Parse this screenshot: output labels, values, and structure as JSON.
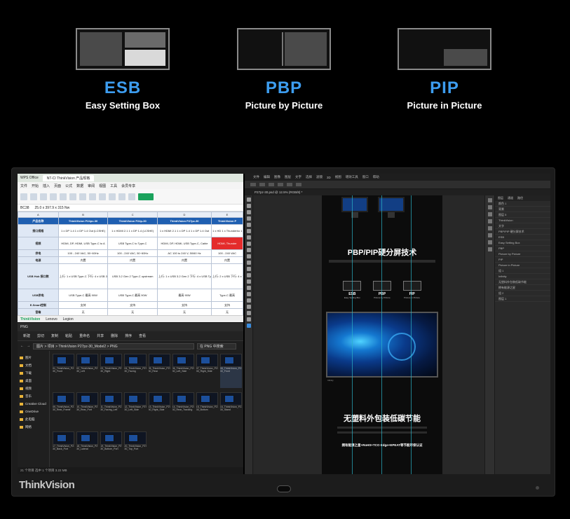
{
  "modes": [
    {
      "title": "ESB",
      "subtitle": "Easy Setting Box"
    },
    {
      "title": "PBP",
      "subtitle": "Picture by Picture"
    },
    {
      "title": "PIP",
      "subtitle": "Picture in Picture"
    }
  ],
  "monitor": {
    "brand": "ThinkVision"
  },
  "spreadsheet": {
    "app_tab": "WPS Office",
    "file_tab": "NT-CI ThinkVision 产品规格",
    "menus": [
      "文件",
      "开始",
      "插入",
      "页面",
      "公式",
      "数据",
      "审阅",
      "视图",
      "工具",
      "会员专享"
    ],
    "cell_ref": "BC38",
    "formula": "25.0 x 397.9 x 315 Nw",
    "columns": [
      "A",
      "B",
      "C",
      "D",
      "E"
    ],
    "header_row": [
      "产品名称",
      "ThinkVision P24pv-30",
      "ThinkVision P24p-30",
      "ThinkVision P27pz-30",
      "ThinkVision P"
    ],
    "rows": [
      {
        "label": "接口规格",
        "cells": [
          "1 x DP 1.4\n1 x DP 1.4 Out\n(LCSHE)",
          "1 x HDMI 2.1\n1 x DP 1.4\n(LCSHE)",
          "1 x HDMI 2.1\n1 x DP 1.4\n1 x DP 1.4 Out",
          "1 x HD\n1 x Thunderbo\n1 x Thunderbo"
        ]
      },
      {
        "label": "视频",
        "cells": [
          "HDMI, DP, HDMI, USB Type-C to A",
          "USB Type-C to Type-C",
          "HDMI, DP, HDMI, USB Type-C, Cable",
          "HDMI, Thunder"
        ]
      },
      {
        "label": "供电",
        "cells": [
          "100 - 240 VAC, 50~60Hz",
          "100 - 240 VAC, 50~60Hz",
          "AC 100 to 240 V, 50/60 Hz",
          "100 - 240 VAC"
        ]
      },
      {
        "label": "电源",
        "cells": [
          "内置",
          "内置",
          "内置",
          "内置"
        ]
      },
      {
        "label": "USB Hub 接口数",
        "cells": [
          "上行: 1 x USB Type-C\n下行: 4 x USB 3.2 Gen 2",
          "USB 3.2 Gen 2\nType-C upstream",
          "上行: 1 x USB 3.2 Gen 2\n下行: 4 x USB Type-A",
          "上行: 2 x USB\n下行: 4 x Thu"
        ]
      },
      {
        "label": "USB供电",
        "cells": [
          "USB Type-C 最高 90W",
          "USB Type-C 最高 90W",
          "最高 90W",
          "Type-C 最高"
        ]
      },
      {
        "label": "E-Smart控制",
        "cells": [
          "支持",
          "支持",
          "支持",
          "支持"
        ]
      },
      {
        "label": "音箱",
        "cells": [
          "无",
          "无",
          "无",
          "无"
        ]
      }
    ],
    "sheet_tabs": [
      "ThinkVision",
      "Lenovo",
      "Legion"
    ],
    "active_sheet": "ThinkVision"
  },
  "explorer": {
    "title": "PNG",
    "tools": [
      "新建",
      "剪切",
      "复制",
      "粘贴",
      "重命名",
      "共享",
      "删除",
      "排序",
      "查看"
    ],
    "path": "图片 > 项目 > ThinkVision P27pz-30_Model2 > PNG",
    "search_placeholder": "在 PNG 中搜索",
    "nav": [
      "图片",
      "文档",
      "下载",
      "桌面",
      "视频",
      "音乐",
      "Creative Cloud",
      "OneDrive",
      "此电脑",
      "网络"
    ],
    "files": [
      "01_ThinkVision_P27pz-30_Front",
      "02_ThinkVision_P27pz-30_Left",
      "03_ThinkVision_P27pz-30_Right",
      "04_ThinkVision_P27pz-30_Facing",
      "05_ThinkVision_P27pz-30_Rear",
      "06_ThinkVision_P27pz-30_Left_Side",
      "07_ThinkVision_P27pz-30_Right_Side",
      "08_ThinkVision_P27pz-30_Front",
      "09_ThinkVision_P27pz-30_Rear_Frame",
      "10_ThinkVision_P27pz-30_Rear_Port",
      "11_ThinkVision_P27pz-30_Facing_Left",
      "12_ThinkVision_P27pz-30_Left_Side",
      "13_ThinkVision_P27pz-30_Right_Side",
      "14_ThinkVision_P27pz-30_Rear_Tracking",
      "15_ThinkVision_P27pz-30_Bottom",
      "16_ThinkVision_P27pz-30_Stand",
      "17_ThinkVision_P27pz-30_Back_Port",
      "18_ThinkVision_P27pz-30_Lateral",
      "19_ThinkVision_P27pz-30_Bottom_Port",
      "20_ThinkVision_P27pz-30_Top_Port"
    ],
    "status": "21 个项目  选中 1 个项目  3.22 MB"
  },
  "photoshop": {
    "menus": [
      "文件",
      "编辑",
      "图像",
      "图层",
      "文字",
      "选择",
      "滤镜",
      "3D",
      "视图",
      "增效工具",
      "窗口",
      "帮助"
    ],
    "tab": "P27pz-30.psd @ 12.5% (RGB/8) *",
    "doc_heading_1": "PBP/PIP硬分屏技术",
    "doc_minis": [
      {
        "title": "ESB",
        "subtitle": "Easy Setting Box"
      },
      {
        "title": "PBP",
        "subtitle": "Picture by Picture"
      },
      {
        "title": "PIP",
        "subtitle": "Picture in Picture"
      }
    ],
    "hero_caption": "Infinity",
    "doc_heading_2": "无塑料外包装低碳节能",
    "doc_footer": "拥有能源之星+RoHS+TCO Edge+EPEAT等节能环保认证",
    "panel_tabs": [
      "图层",
      "通道",
      "路径"
    ],
    "layers": [
      "颜色 1",
      "背景",
      "图层 5",
      "ThinkVision",
      "文字",
      "PBP/PIP 硬分屏技术",
      "ESB",
      "Easy Setting Box",
      "PBP",
      "Picture by Picture",
      "PIP",
      "Picture in Picture",
      "组 1",
      "Infinity",
      "无塑料外包装低碳节能",
      "拥有能源之星",
      "组 2",
      "图层 1"
    ]
  }
}
